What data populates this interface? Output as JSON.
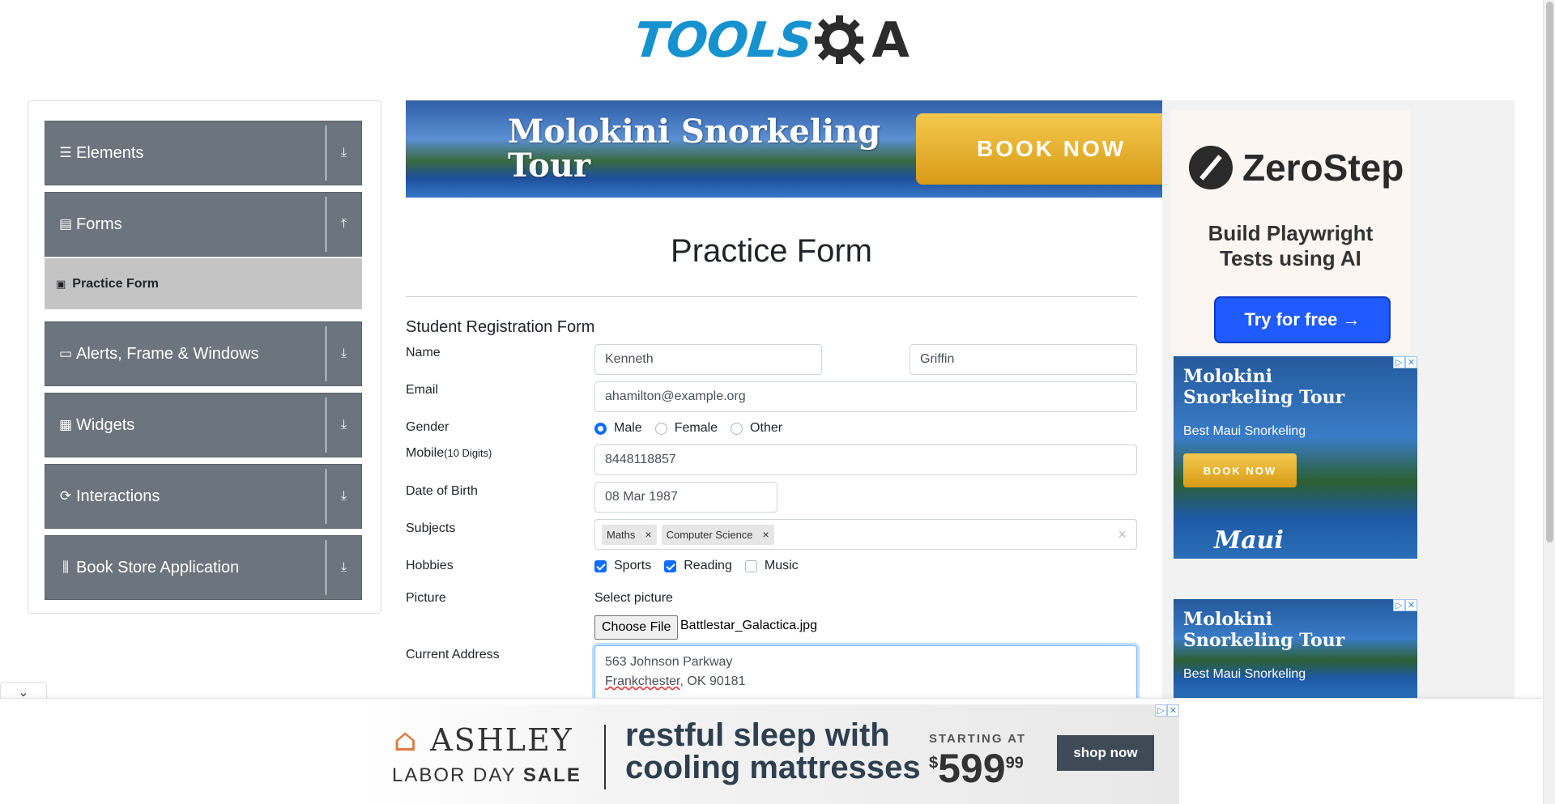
{
  "header": {
    "logo_tools": "TOOLS",
    "logo_qa": "A"
  },
  "sidebar": {
    "groups": [
      {
        "label": "Elements",
        "icon": "hamburger-icon",
        "arrow": "download-arrow-icon"
      },
      {
        "label": "Forms",
        "icon": "document-icon",
        "arrow": "upload-arrow-icon"
      },
      {
        "label": "Alerts, Frame & Windows",
        "icon": "window-icon",
        "arrow": "download-arrow-icon"
      },
      {
        "label": "Widgets",
        "icon": "widgets-icon",
        "arrow": "download-arrow-icon"
      },
      {
        "label": "Interactions",
        "icon": "interactions-icon",
        "arrow": "download-arrow-icon"
      },
      {
        "label": "Book Store Application",
        "icon": "books-icon",
        "arrow": "download-arrow-icon"
      }
    ],
    "active_item": "Practice Form"
  },
  "top_ad": {
    "title": "Molokini Snorkeling Tour",
    "button": "BOOK NOW"
  },
  "right_ads": {
    "zerostep": {
      "name": "ZeroStep",
      "tagline": "Build Playwright Tests using AI",
      "button": "Try for free →"
    },
    "molokini_1": {
      "title": "Molokini Snorkeling Tour",
      "subtitle": "Best Maui Snorkeling",
      "button": "BOOK NOW",
      "brand": "Maui"
    },
    "molokini_2": {
      "title": "Molokini Snorkeling Tour",
      "subtitle": "Best Maui Snorkeling"
    }
  },
  "page": {
    "title": "Practice Form",
    "form_heading": "Student Registration Form"
  },
  "form": {
    "name_label": "Name",
    "first_name": "Kenneth",
    "last_name": "Griffin",
    "email_label": "Email",
    "email": "ahamilton@example.org",
    "gender_label": "Gender",
    "gender_options": [
      "Male",
      "Female",
      "Other"
    ],
    "gender_selected": "Male",
    "mobile_label": "Mobile",
    "mobile_hint": "(10 Digits)",
    "mobile": "8448118857",
    "dob_label": "Date of Birth",
    "dob": "08 Mar 1987",
    "subjects_label": "Subjects",
    "subjects": [
      "Maths",
      "Computer Science"
    ],
    "hobbies_label": "Hobbies",
    "hobbies": [
      {
        "label": "Sports",
        "checked": true
      },
      {
        "label": "Reading",
        "checked": true
      },
      {
        "label": "Music",
        "checked": false
      }
    ],
    "picture_label": "Picture",
    "select_picture": "Select picture",
    "choose_file": "Choose File",
    "file_name": "Battlestar_Galactica.jpg",
    "address_label": "Current Address",
    "address_line1": "563 Johnson Parkway",
    "address_line2_word1": "Frankchester",
    "address_line2_rest": ", OK 90181"
  },
  "bottom_ad": {
    "brand": "ASHLEY",
    "sub_normal": "LABOR DAY ",
    "sub_bold": "SALE",
    "headline_1": "restful sleep with",
    "headline_2": "cooling mattresses",
    "starting": "STARTING AT",
    "price_sym": "$",
    "price": "599",
    "price_cents": "99",
    "button": "shop now"
  },
  "colors": {
    "sidebar_group": "#6c757d",
    "active_item": "#c4c4c4",
    "accent": "#0d6efd",
    "logo_blue": "#1692cf"
  }
}
